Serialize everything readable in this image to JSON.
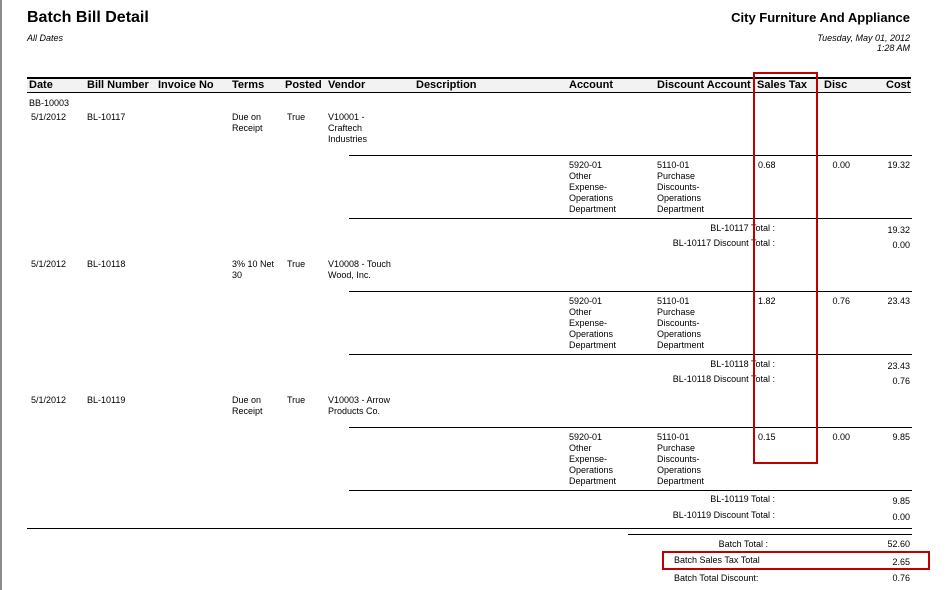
{
  "report": {
    "title": "Batch Bill Detail",
    "subtitle": "All Dates",
    "company": "City Furniture And Appliance",
    "date": "Tuesday, May 01, 2012",
    "time": "1:28 AM"
  },
  "columns": {
    "date": "Date",
    "bill_number": "Bill Number",
    "invoice_no": "Invoice No",
    "terms": "Terms",
    "posted": "Posted",
    "vendor": "Vendor",
    "description": "Description",
    "account": "Account",
    "discount_account": "Discount Account",
    "sales_tax": "Sales Tax",
    "disc": "Disc",
    "cost": "Cost"
  },
  "batch_id": "BB-10003",
  "bills": [
    {
      "date": "5/1/2012",
      "bill_number": "BL-10117",
      "terms": "Due on\nReceipt",
      "posted": "True",
      "vendor": "V10001 -\nCraftech\nIndustries",
      "line": {
        "account": "5920-01\nOther\nExpense-\nOperations\nDepartment",
        "discount_account": "5110-01\nPurchase\nDiscounts-\nOperations\nDepartment",
        "sales_tax": "0.68",
        "disc": "0.00",
        "cost": "19.32"
      },
      "total_label": "BL-10117 Total :",
      "total": "19.32",
      "discount_total_label": "BL-10117 Discount Total :",
      "discount_total": "0.00"
    },
    {
      "date": "5/1/2012",
      "bill_number": "BL-10118",
      "terms": "3% 10 Net\n30",
      "posted": "True",
      "vendor": "V10008 - Touch\nWood, Inc.",
      "line": {
        "account": "5920-01\nOther\nExpense-\nOperations\nDepartment",
        "discount_account": "5110-01\nPurchase\nDiscounts-\nOperations\nDepartment",
        "sales_tax": "1.82",
        "disc": "0.76",
        "cost": "23.43"
      },
      "total_label": "BL-10118 Total :",
      "total": "23.43",
      "discount_total_label": "BL-10118 Discount Total :",
      "discount_total": "0.76"
    },
    {
      "date": "5/1/2012",
      "bill_number": "BL-10119",
      "terms": "Due on\nReceipt",
      "posted": "True",
      "vendor": "V10003 - Arrow\nProducts Co.",
      "line": {
        "account": "5920-01\nOther\nExpense-\nOperations\nDepartment",
        "discount_account": "5110-01\nPurchase\nDiscounts-\nOperations\nDepartment",
        "sales_tax": "0.15",
        "disc": "0.00",
        "cost": "9.85"
      },
      "total_label": "BL-10119 Total :",
      "total": "9.85",
      "discount_total_label": "BL-10119 Discount Total :",
      "discount_total": "0.00"
    }
  ],
  "batch_totals": {
    "total_label": "Batch Total :",
    "total": "52.60",
    "sales_tax_label": "Batch Sales Tax Total",
    "sales_tax": "2.65",
    "discount_label": "Batch Total Discount:",
    "discount": "0.76"
  },
  "highlight_color": "#c00000"
}
